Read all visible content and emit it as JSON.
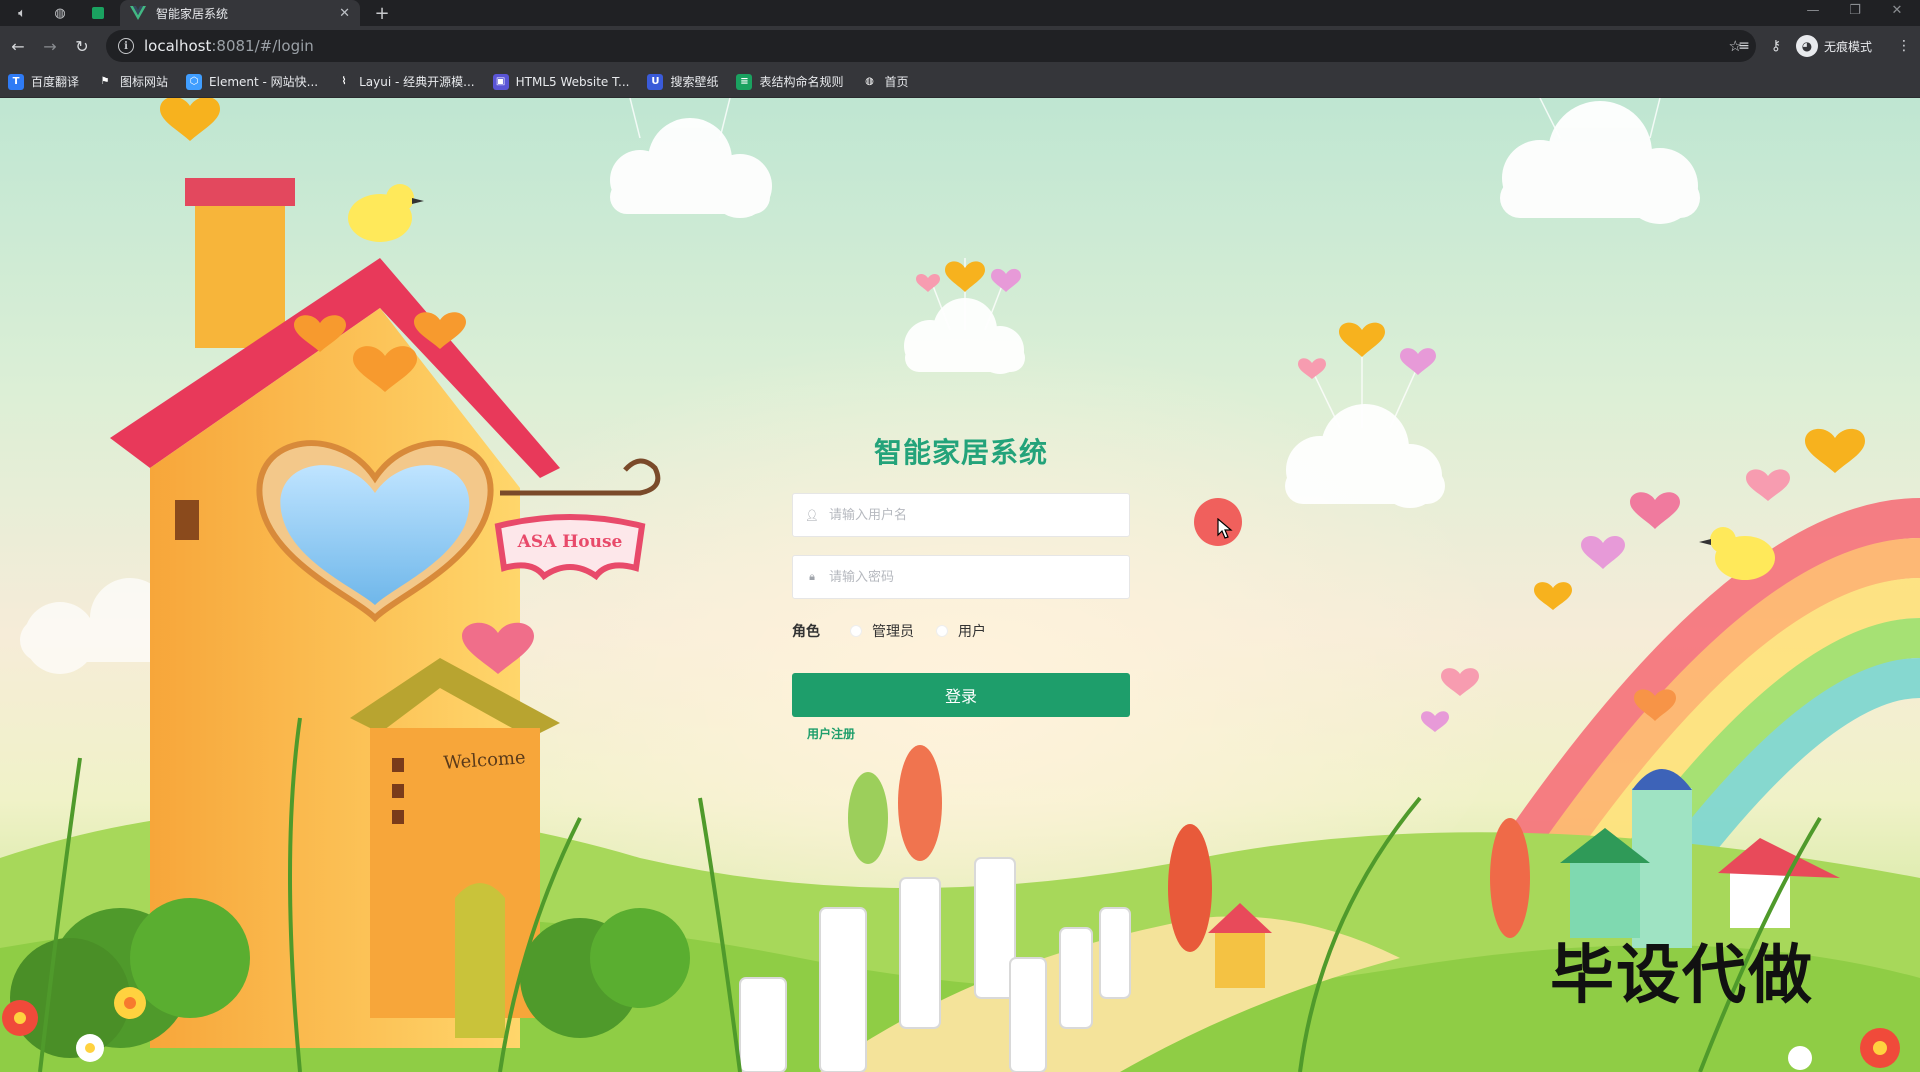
{
  "browser": {
    "tab_title": "智能家居系统",
    "url_host": "localhost",
    "url_path": ":8081/#/login",
    "incognito_label": "无痕模式",
    "bookmarks": [
      {
        "label": "百度翻译",
        "icon": "translate-icon",
        "color": "#2f7bf5",
        "glyph": "T"
      },
      {
        "label": "图标网站",
        "icon": "flag-icon",
        "color": "#35363a",
        "glyph": "⚑"
      },
      {
        "label": "Element - 网站快...",
        "icon": "element-icon",
        "color": "#409eff",
        "glyph": "⬡"
      },
      {
        "label": "Layui - 经典开源模...",
        "icon": "layui-icon",
        "color": "#35363a",
        "glyph": "⌇"
      },
      {
        "label": "HTML5 Website T...",
        "icon": "html5-icon",
        "color": "#5a55d6",
        "glyph": "▣"
      },
      {
        "label": "搜索壁纸",
        "icon": "wallpaper-icon",
        "color": "#3a5bd9",
        "glyph": "U"
      },
      {
        "label": "表结构命名规则",
        "icon": "table-icon",
        "color": "#1aa260",
        "glyph": "≡"
      },
      {
        "label": "首页",
        "icon": "globe-icon",
        "color": "#35363a",
        "glyph": "◍"
      }
    ]
  },
  "login": {
    "title": "智能家居系统",
    "username_placeholder": "请输入用户名",
    "password_placeholder": "请输入密码",
    "role_label": "角色",
    "roles": [
      "管理员",
      "用户"
    ],
    "login_button": "登录",
    "register_link": "用户注册"
  },
  "scene": {
    "sign_text": "ASA House",
    "door_text": "Welcome"
  },
  "watermark": "毕设代做"
}
